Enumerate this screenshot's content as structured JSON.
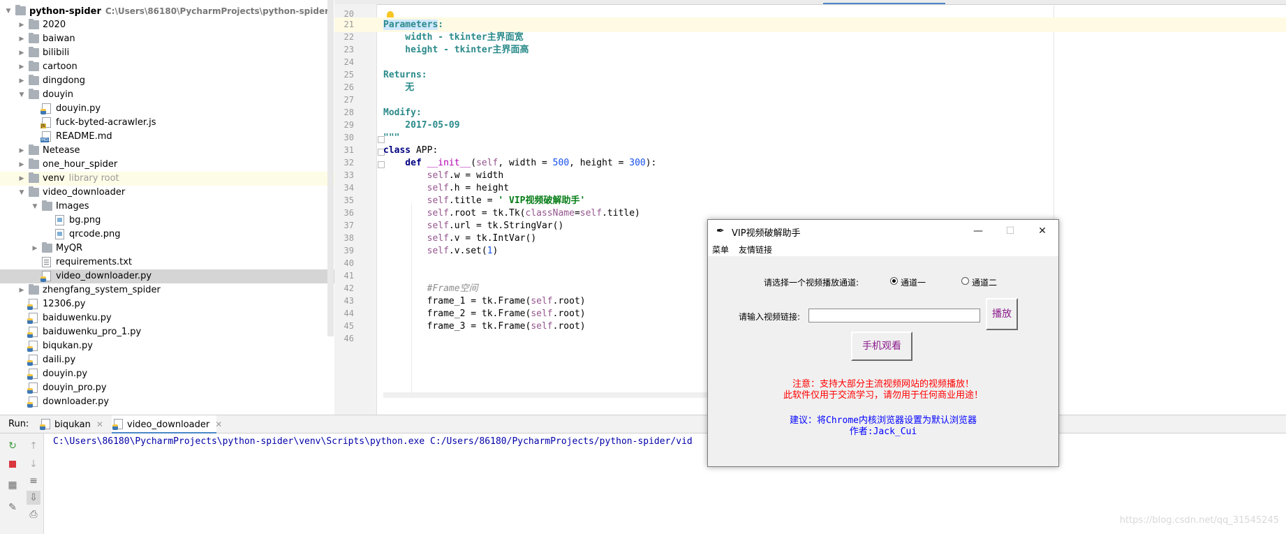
{
  "project_tree": {
    "items": [
      {
        "label": "python-spider",
        "path": "C:\\Users\\86180\\PycharmProjects\\python-spider",
        "type": "folder",
        "expanded": true
      },
      {
        "label": "2020",
        "type": "folder",
        "expanded": false
      },
      {
        "label": "baiwan",
        "type": "folder",
        "expanded": false
      },
      {
        "label": "bilibili",
        "type": "folder",
        "expanded": false
      },
      {
        "label": "cartoon",
        "type": "folder",
        "expanded": false
      },
      {
        "label": "dingdong",
        "type": "folder",
        "expanded": false
      },
      {
        "label": "douyin",
        "type": "folder",
        "expanded": true
      },
      {
        "label": "douyin.py",
        "type": "python"
      },
      {
        "label": "fuck-byted-acrawler.js",
        "type": "js"
      },
      {
        "label": "README.md",
        "type": "md"
      },
      {
        "label": "Netease",
        "type": "folder",
        "expanded": false
      },
      {
        "label": "one_hour_spider",
        "type": "folder",
        "expanded": false
      },
      {
        "label": "venv",
        "suffix": "library root",
        "type": "folder",
        "expanded": false
      },
      {
        "label": "video_downloader",
        "type": "folder",
        "expanded": true
      },
      {
        "label": "Images",
        "type": "folder",
        "expanded": true
      },
      {
        "label": "bg.png",
        "type": "image"
      },
      {
        "label": "qrcode.png",
        "type": "image"
      },
      {
        "label": "MyQR",
        "type": "folder",
        "expanded": false
      },
      {
        "label": "requirements.txt",
        "type": "text"
      },
      {
        "label": "video_downloader.py",
        "type": "python",
        "selected": true
      },
      {
        "label": "zhengfang_system_spider",
        "type": "folder",
        "expanded": false
      },
      {
        "label": "12306.py",
        "type": "python"
      },
      {
        "label": "baiduwenku.py",
        "type": "python"
      },
      {
        "label": "baiduwenku_pro_1.py",
        "type": "python"
      },
      {
        "label": "biqukan.py",
        "type": "python"
      },
      {
        "label": "daili.py",
        "type": "python"
      },
      {
        "label": "douyin.py",
        "type": "python"
      },
      {
        "label": "douyin_pro.py",
        "type": "python"
      },
      {
        "label": "downloader.py",
        "type": "python"
      }
    ]
  },
  "editor": {
    "line_numbers": [
      "20",
      "21",
      "22",
      "23",
      "24",
      "25",
      "26",
      "27",
      "28",
      "29",
      "30",
      "31",
      "32",
      "33",
      "34",
      "35",
      "36",
      "37",
      "38",
      "39",
      "40",
      "41",
      "42",
      "43",
      "44",
      "45",
      "46"
    ],
    "code": {
      "l21": "Parameters",
      "l21b": ":",
      "l22": "    width - tkinter主界面宽",
      "l23": "    height - tkinter主界面高",
      "l25": "Returns:",
      "l26": "    无",
      "l28": "Modify:",
      "l29": "    2017-05-09",
      "l30": "\"\"\"",
      "l31a": "class",
      "l31b": " APP:",
      "l32a": "    def ",
      "l32b": "__init__",
      "l32c": "(",
      "l32d": "self",
      "l32e": ", width = ",
      "l32f": "500",
      "l32g": ", height = ",
      "l32h": "300",
      "l32i": "):",
      "l33a": "        self",
      "l33b": ".w = width",
      "l34a": "        self",
      "l34b": ".h = height",
      "l35a": "        self",
      "l35b": ".title = ",
      "l35c": "' VIP视频破解助手'",
      "l36a": "        self",
      "l36b": ".root = tk.Tk(",
      "l36c": "className",
      "l36d": "=",
      "l36e": "self",
      "l36f": ".title)",
      "l37a": "        self",
      "l37b": ".url = tk.StringVar()",
      "l38a": "        self",
      "l38b": ".v = tk.IntVar()",
      "l39a": "        self",
      "l39b": ".v.set(",
      "l39c": "1",
      "l39d": ")",
      "l42": "        #Frame空间",
      "l43a": "        frame_1 = tk.Frame(",
      "l43b": "self",
      "l43c": ".root)",
      "l44a": "        frame_2 = tk.Frame(",
      "l44b": "self",
      "l44c": ".root)",
      "l45a": "        frame_3 = tk.Frame(",
      "l45b": "self",
      "l45c": ".root)"
    }
  },
  "run_panel": {
    "label": "Run:",
    "tabs": [
      {
        "label": "biqukan",
        "active": false
      },
      {
        "label": "video_downloader",
        "active": true
      }
    ],
    "console": "C:\\Users\\86180\\PycharmProjects\\python-spider\\venv\\Scripts\\python.exe C:/Users/86180/PycharmProjects/python-spider/vid",
    "toolbar_icons": [
      "rerun-icon",
      "stop-icon",
      "up-arrow-icon",
      "down-arrow-icon",
      "soft-wrap-icon",
      "layout-icon",
      "scroll-to-end-icon",
      "pin-icon",
      "print-icon"
    ]
  },
  "dialog": {
    "title": "VIP视频破解助手",
    "menu": [
      "菜单",
      "友情链接"
    ],
    "channel_prompt": "请选择一个视频播放通道:",
    "channel_1": "通道一",
    "channel_2": "通道二",
    "selected_channel": 1,
    "url_prompt": "请输入视频链接:",
    "url_value": "",
    "play_button": "播放",
    "mobile_button": "手机观看",
    "notice_1": "注意：支持大部分主流视频网站的视频播放！",
    "notice_2": "此软件仅用于交流学习，请勿用于任何商业用途！",
    "suggestion": "建议：将Chrome内核浏览器设置为默认浏览器",
    "author": "作者:Jack_Cui",
    "colors": {
      "notice": "#ff0000",
      "suggestion": "#0000ff",
      "button_text": "#8b1c8b"
    }
  },
  "watermark": "https://blog.csdn.net/qq_31545245"
}
